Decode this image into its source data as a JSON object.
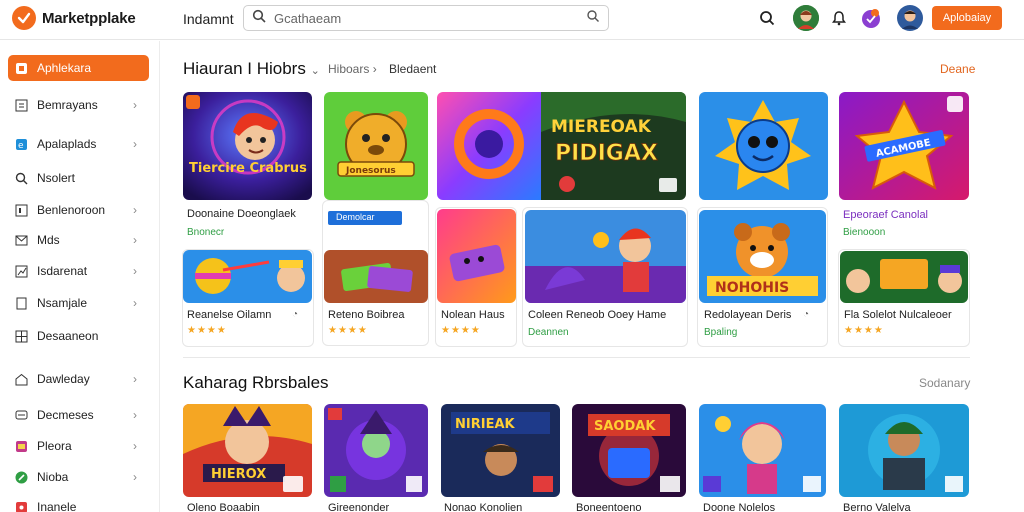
{
  "header": {
    "brand": "Marketpplake",
    "nav_link": "Indamnt",
    "search_placeholder": "Gcathaeam",
    "cta_label": "Aplobaiay"
  },
  "sidebar": {
    "items": [
      {
        "label": "Aphlekara",
        "icon": "bag-icon",
        "active": true
      },
      {
        "label": "Bemrayans",
        "icon": "grid-icon"
      },
      {
        "label": "Apalaplads",
        "icon": "edge-icon"
      },
      {
        "label": "Nsolert",
        "icon": "search-icon"
      },
      {
        "label": "Benlenoroon",
        "icon": "square-icon"
      },
      {
        "label": "Mds",
        "icon": "mail-icon"
      },
      {
        "label": "Isdarenat",
        "icon": "chart-icon"
      },
      {
        "label": "Nsamjale",
        "icon": "doc-icon"
      },
      {
        "label": "Desaaneon",
        "icon": "table-icon"
      },
      {
        "label": "Dawleday",
        "icon": "home-icon"
      },
      {
        "label": "Decmeses",
        "icon": "message-icon"
      },
      {
        "label": "Pleora",
        "icon": "photo-icon"
      },
      {
        "label": "Nioba",
        "icon": "leaf-icon"
      },
      {
        "label": "Inanele",
        "icon": "tag-icon"
      }
    ]
  },
  "section1": {
    "title": "Hiauran I Hiobrs",
    "crumb1": "Hiboars",
    "crumb2": "Bledaent",
    "see_all": "Deane"
  },
  "cards_top": [
    {
      "title": "Doonaine Doeonglaek",
      "sub": "Bnonecr"
    },
    {
      "chip": "Demolcar"
    },
    {
      "title": "Epeoraef Canolal",
      "sub": "Bienooon"
    }
  ],
  "cards_bottom": [
    {
      "title": "Reanelse Oilamn",
      "stars": "★★★★"
    },
    {
      "title": "Reteno Boibrea",
      "stars": "★★★★"
    },
    {
      "title": "Nolean Haus",
      "stars": "★★★★"
    },
    {
      "title": "Coleen Reneob Ooey Hame",
      "sub": "Deannen"
    },
    {
      "title": "Redolayean Deris",
      "sub": "Bpaling"
    },
    {
      "title": "Fla Solelot Nulcaleoer",
      "stars": "★★★★"
    }
  ],
  "section2": {
    "title": "Kaharag Rbrsbales",
    "link": "Sodanary"
  },
  "row2_titles": [
    "Oleno Boaabin",
    "Gireenonder",
    "Nonao Konolien",
    "Boneentoeno",
    "Doone Nolelos",
    "Berno Valelva"
  ],
  "art_text": {
    "t1": "Tiercire Crabrus",
    "t2": "Jonesorus",
    "t3a": "MIEREOAK",
    "t3b": "PIDIGAX",
    "t4": "ACAMOBE",
    "t5": "NOHOHIS",
    "r1": "HIEROX",
    "r3": "NIRIEAK",
    "r4": "SAODAK"
  },
  "colors": {
    "accent": "#f26b1d",
    "chip": "#1e6fd9",
    "success": "#2f9e44",
    "star": "#f5a623"
  }
}
